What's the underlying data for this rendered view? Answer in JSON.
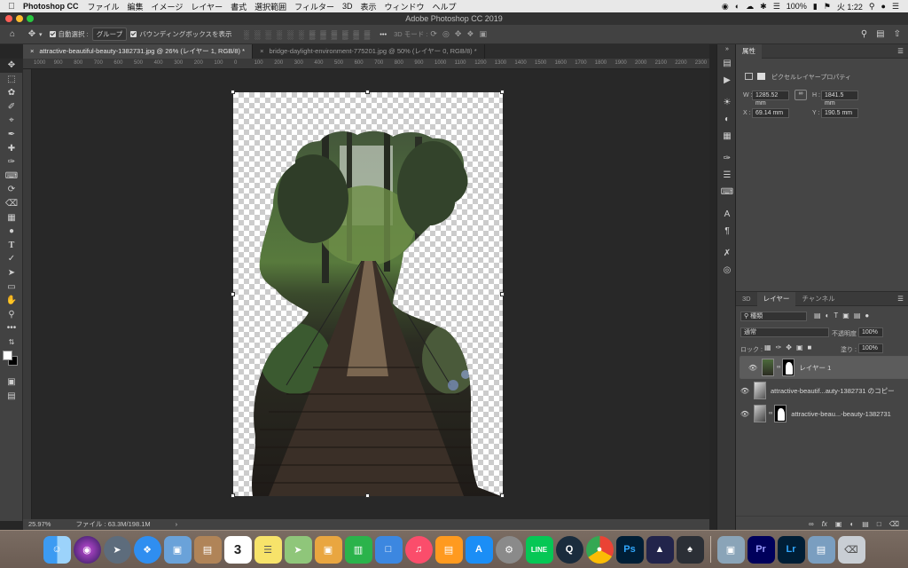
{
  "menubar": {
    "app_name": "Photoshop CC",
    "items": [
      "ファイル",
      "編集",
      "イメージ",
      "レイヤー",
      "書式",
      "選択範囲",
      "フィルター",
      "3D",
      "表示",
      "ウィンドウ",
      "ヘルプ"
    ],
    "battery": "100%",
    "clock": "火 1:22"
  },
  "window_title": "Adobe Photoshop CC 2019",
  "options": {
    "auto_select_label": "自動選択 :",
    "auto_select_value": "グループ",
    "bounding_box_label": "バウンディングボックスを表示",
    "mode_3d": "3D モード :"
  },
  "tabs": [
    {
      "label": "attractive-beautiful-beauty-1382731.jpg @ 26% (レイヤー 1, RGB/8) *"
    },
    {
      "label": "bridge-daylight-environment-775201.jpg @ 50% (レイヤー 0, RGB/8) *"
    }
  ],
  "ruler_ticks": [
    "1000",
    "900",
    "800",
    "700",
    "600",
    "500",
    "400",
    "300",
    "200",
    "100",
    "0",
    "100",
    "200",
    "300",
    "400",
    "500",
    "600",
    "700",
    "800",
    "900",
    "1000",
    "1100",
    "1200",
    "1300",
    "1400",
    "1500",
    "1600",
    "1700",
    "1800",
    "1900",
    "2000",
    "2100",
    "2200",
    "2300"
  ],
  "status": {
    "zoom": "25.97%",
    "file": "ファイル : 63.3M/198.1M"
  },
  "properties": {
    "tab": "属性",
    "title": "ピクセルレイヤープロパティ",
    "w_label": "W :",
    "w_value": "1285.52 mm",
    "h_label": "H :",
    "h_value": "1841.5 mm",
    "x_label": "X :",
    "x_value": "69.14 mm",
    "y_label": "Y :",
    "y_value": "190.5 mm"
  },
  "layers_panel": {
    "tabs": [
      "3D",
      "レイヤー",
      "チャンネル"
    ],
    "filter": "種類",
    "blend_mode": "通常",
    "opacity_label": "不透明度 :",
    "opacity_value": "100%",
    "lock_label": "ロック :",
    "fill_label": "塗り :",
    "fill_value": "100%",
    "layers": [
      {
        "name": "レイヤー 1",
        "selected": true
      },
      {
        "name": "attractive-beautif...auty-1382731 のコピー",
        "selected": false
      },
      {
        "name": "attractive-beau...-beauty-1382731",
        "selected": false
      }
    ],
    "bottom_icons": [
      "link-icon",
      "fx-icon",
      "mask-icon",
      "adjustment-icon",
      "folder-icon",
      "new-layer-icon",
      "trash-icon"
    ]
  },
  "dock": {
    "calendar_day": "3",
    "apps": [
      "Finder",
      "Siri",
      "Launchpad",
      "Safari",
      "Preview",
      "Notes",
      "Calendar",
      "Stickies",
      "Maps",
      "Photos",
      "Numbers",
      "Keynote",
      "Music",
      "Books",
      "App Store",
      "System Preferences",
      "LINE",
      "QuickTime",
      "Chrome",
      "Ps",
      "Lr"
    ]
  },
  "colors": {
    "ps_blue": "#31a8ff",
    "pr_purple": "#9999ff",
    "lr_blue": "#31a8ff"
  }
}
